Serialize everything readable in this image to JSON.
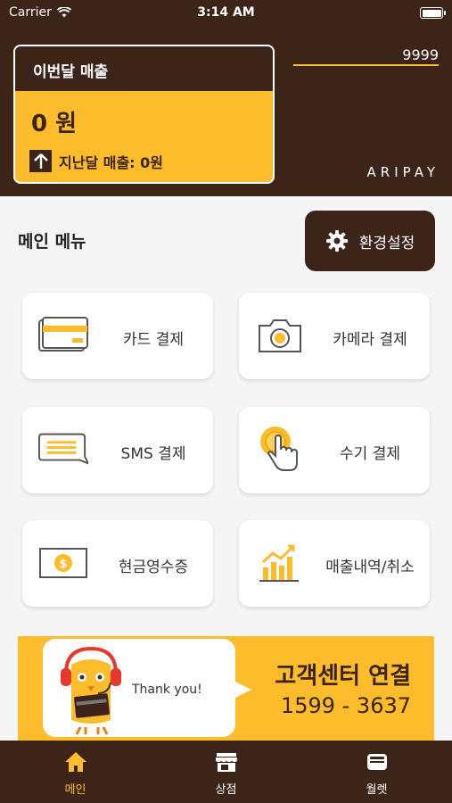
{
  "status": {
    "carrier": "Carrier",
    "time": "3:14 AM"
  },
  "sales": {
    "title": "이번달 매출",
    "amount": "0 원",
    "last_month": "지난달 매출: 0원"
  },
  "terminal_id": "9999",
  "brand": "ARIPAY",
  "main_menu_title": "메인 메뉴",
  "settings_label": "환경설정",
  "menu": {
    "card": "카드 결제",
    "camera": "카메라 결제",
    "sms": "SMS 결제",
    "manual": "수기 결제",
    "cash_receipt": "현금영수증",
    "sales_history": "매출내역/취소"
  },
  "banner": {
    "thanks": "Thank you!",
    "title": "고객센터 연결",
    "phone": "1599 - 3637"
  },
  "tabs": {
    "main": "메인",
    "store": "상점",
    "wallet": "월렛"
  },
  "colors": {
    "brown": "#3d2418",
    "yellow": "#fcbc2b"
  }
}
